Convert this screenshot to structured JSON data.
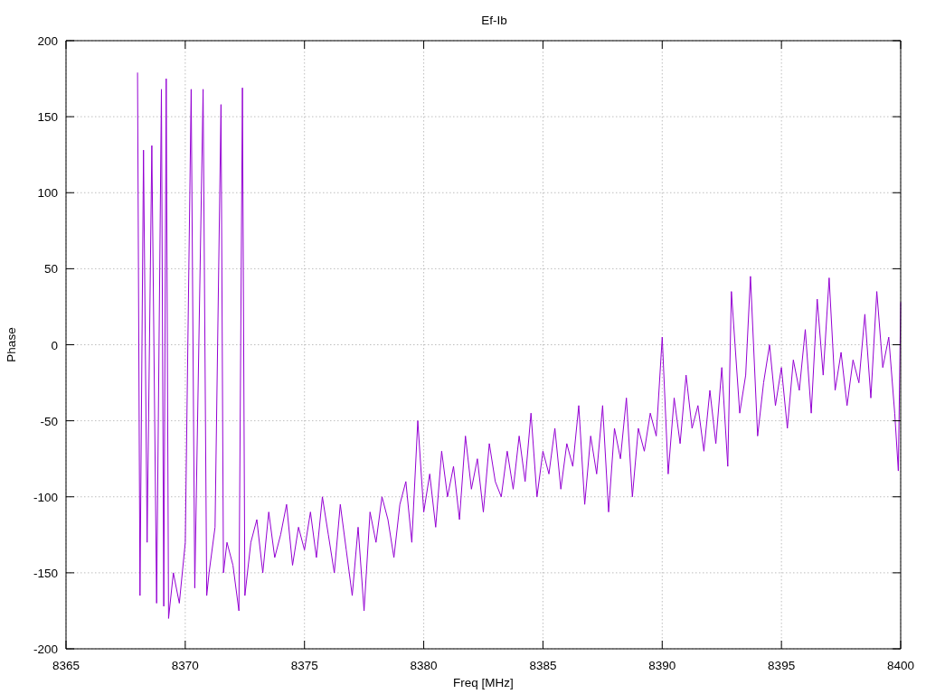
{
  "chart_data": {
    "type": "line",
    "grid": true,
    "title": "Ef-Ib",
    "xlabel": "Freq [MHz]",
    "ylabel": "Phase",
    "xlim": [
      8365,
      8400
    ],
    "ylim": [
      -200,
      200
    ],
    "xticks": [
      8365,
      8370,
      8375,
      8380,
      8385,
      8390,
      8395,
      8400
    ],
    "yticks": [
      -200,
      -150,
      -100,
      -50,
      0,
      50,
      100,
      150,
      200
    ],
    "x": [
      8368.0,
      8368.1,
      8368.25,
      8368.4,
      8368.6,
      8368.8,
      8369.0,
      8369.1,
      8369.2,
      8369.3,
      8369.5,
      8369.75,
      8370.0,
      8370.25,
      8370.4,
      8370.75,
      8370.9,
      8371.0,
      8371.25,
      8371.5,
      8371.6,
      8371.75,
      8372.0,
      8372.25,
      8372.4,
      8372.5,
      8372.75,
      8373.0,
      8373.25,
      8373.5,
      8373.75,
      8374.0,
      8374.25,
      8374.5,
      8374.75,
      8375.0,
      8375.25,
      8375.5,
      8375.75,
      8376.0,
      8376.25,
      8376.5,
      8376.75,
      8377.0,
      8377.25,
      8377.5,
      8377.75,
      8378.0,
      8378.25,
      8378.5,
      8378.75,
      8379.0,
      8379.25,
      8379.5,
      8379.75,
      8380.0,
      8380.25,
      8380.5,
      8380.75,
      8381.0,
      8381.25,
      8381.5,
      8381.75,
      8382.0,
      8382.25,
      8382.5,
      8382.75,
      8383.0,
      8383.25,
      8383.5,
      8383.75,
      8384.0,
      8384.25,
      8384.5,
      8384.75,
      8385.0,
      8385.25,
      8385.5,
      8385.75,
      8386.0,
      8386.25,
      8386.5,
      8386.75,
      8387.0,
      8387.25,
      8387.5,
      8387.75,
      8388.0,
      8388.25,
      8388.5,
      8388.75,
      8389.0,
      8389.25,
      8389.5,
      8389.75,
      8390.0,
      8390.25,
      8390.5,
      8390.75,
      8391.0,
      8391.25,
      8391.5,
      8391.75,
      8392.0,
      8392.25,
      8392.5,
      8392.75,
      8392.9,
      8393.25,
      8393.5,
      8393.7,
      8394.0,
      8394.25,
      8394.5,
      8394.75,
      8395.0,
      8395.25,
      8395.5,
      8395.75,
      8396.0,
      8396.25,
      8396.5,
      8396.75,
      8397.0,
      8397.25,
      8397.5,
      8397.75,
      8398.0,
      8398.25,
      8398.5,
      8398.75,
      8399.0,
      8399.25,
      8399.5,
      8399.75,
      8399.9,
      8400.0
    ],
    "series": [
      {
        "color": "#9400d3",
        "values": [
          179,
          -165,
          128,
          -130,
          131,
          -170,
          168,
          -172,
          175,
          -180,
          -150,
          -170,
          -130,
          168,
          -160,
          168,
          -165,
          -150,
          -120,
          158,
          -150,
          -130,
          -145,
          -175,
          169,
          -165,
          -130,
          -115,
          -150,
          -110,
          -140,
          -125,
          -105,
          -145,
          -120,
          -135,
          -110,
          -140,
          -100,
          -125,
          -150,
          -105,
          -135,
          -165,
          -120,
          -175,
          -110,
          -130,
          -100,
          -115,
          -140,
          -105,
          -90,
          -130,
          -50,
          -110,
          -85,
          -120,
          -70,
          -100,
          -80,
          -115,
          -60,
          -95,
          -75,
          -110,
          -65,
          -90,
          -100,
          -70,
          -95,
          -60,
          -90,
          -45,
          -100,
          -70,
          -85,
          -55,
          -95,
          -65,
          -80,
          -40,
          -105,
          -60,
          -85,
          -40,
          -110,
          -55,
          -75,
          -35,
          -100,
          -55,
          -70,
          -45,
          -60,
          5,
          -85,
          -35,
          -65,
          -20,
          -55,
          -40,
          -70,
          -30,
          -65,
          -15,
          -80,
          35,
          -45,
          -20,
          45,
          -60,
          -25,
          0,
          -40,
          -15,
          -55,
          -10,
          -30,
          10,
          -45,
          30,
          -20,
          44,
          -30,
          -5,
          -40,
          -10,
          -25,
          20,
          -35,
          35,
          -15,
          5,
          -45,
          -83,
          28
        ]
      }
    ]
  }
}
